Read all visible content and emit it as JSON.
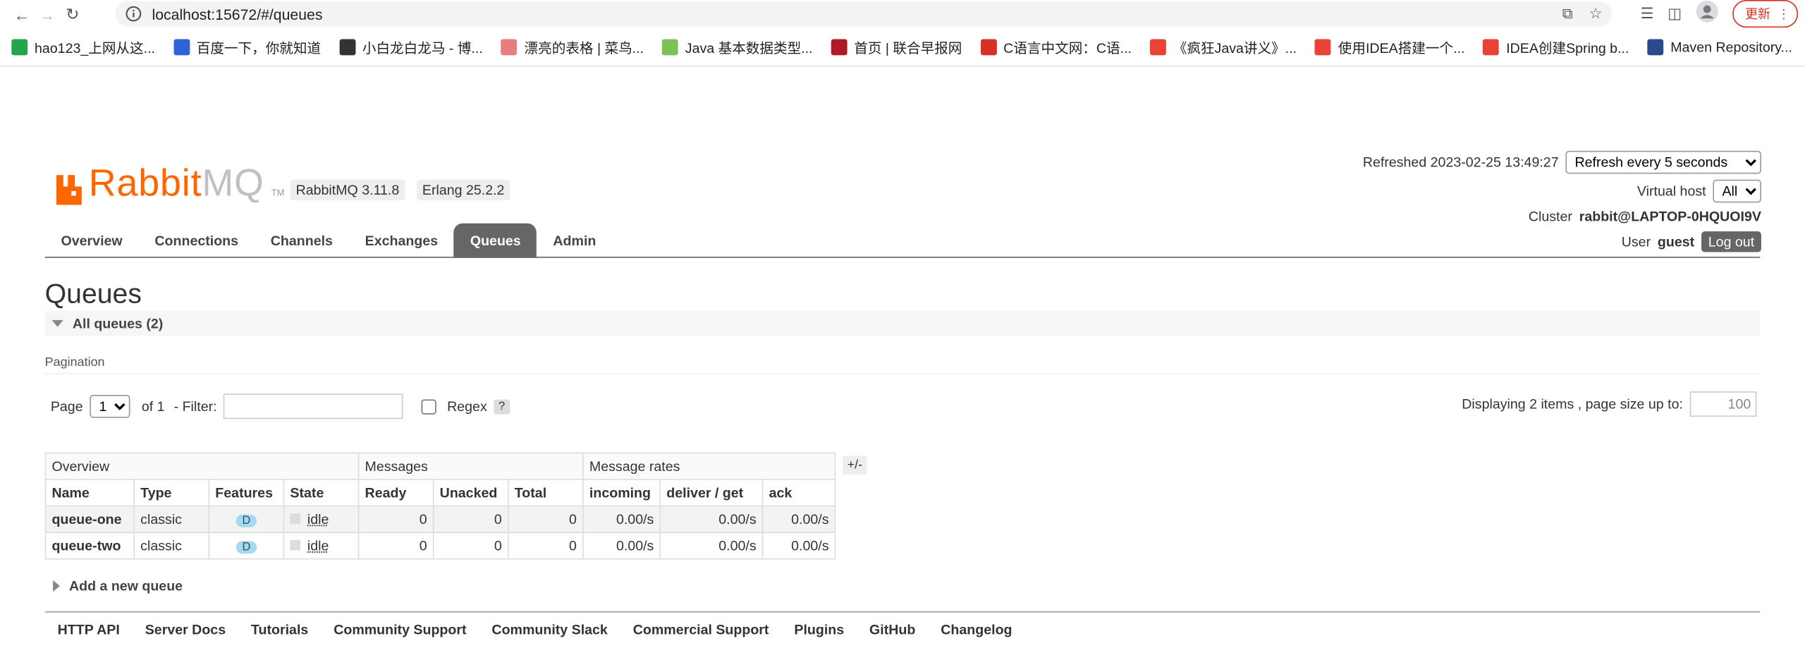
{
  "browser": {
    "url": "localhost:15672/#/queues",
    "update_label": "更新",
    "bookmarks": [
      {
        "label": "hao123_上网从这...",
        "color": "#26a44a"
      },
      {
        "label": "百度一下，你就知道",
        "color": "#2f62db"
      },
      {
        "label": "小白龙白龙马 - 博...",
        "color": "#333333"
      },
      {
        "label": "漂亮的表格 | 菜鸟...",
        "color": "#e67e7e"
      },
      {
        "label": "Java 基本数据类型...",
        "color": "#7fbf5a"
      },
      {
        "label": "首页 | 联合早报网",
        "color": "#b11a24"
      },
      {
        "label": "C语言中文网：C语...",
        "color": "#d93025"
      },
      {
        "label": "《疯狂Java讲义》...",
        "color": "#ea4335"
      },
      {
        "label": "使用IDEA搭建一个...",
        "color": "#ea4335"
      },
      {
        "label": "IDEA创建Spring b...",
        "color": "#ea4335"
      },
      {
        "label": "Maven Repository...",
        "color": "#2b4a8b"
      }
    ],
    "more": "»"
  },
  "header": {
    "logo_main": "Rabbit",
    "logo_mq": "MQ",
    "logo_tm": "TM",
    "rabbitmq_version": "RabbitMQ 3.11.8",
    "erlang_version": "Erlang 25.2.2",
    "refreshed_label": "Refreshed 2023-02-25 13:49:27",
    "refresh_select": "Refresh every 5 seconds",
    "vhost_label": "Virtual host",
    "vhost_value": "All",
    "cluster_label": "Cluster",
    "cluster_value": "rabbit@LAPTOP-0HQUOI9V",
    "user_label": "User",
    "user_value": "guest",
    "logout": "Log out"
  },
  "tabs": [
    "Overview",
    "Connections",
    "Channels",
    "Exchanges",
    "Queues",
    "Admin"
  ],
  "active_tab": "Queues",
  "page": {
    "title": "Queues",
    "section": "All queues (2)",
    "pagination_title": "Pagination",
    "page_label": "Page",
    "page_value": "1",
    "of_label": "of 1",
    "filter_label": "- Filter:",
    "regex_label": "Regex",
    "help": "?",
    "displaying": "Displaying 2 items , page size up to:",
    "page_size": "100",
    "plus_minus": "+/-",
    "add_queue": "Add a new queue"
  },
  "table": {
    "groups": [
      "Overview",
      "Messages",
      "Message rates"
    ],
    "columns": [
      "Name",
      "Type",
      "Features",
      "State",
      "Ready",
      "Unacked",
      "Total",
      "incoming",
      "deliver / get",
      "ack"
    ],
    "rows": [
      {
        "name": "queue-one",
        "type": "classic",
        "feature": "D",
        "state": "idle",
        "ready": "0",
        "unacked": "0",
        "total": "0",
        "incoming": "0.00/s",
        "deliver": "0.00/s",
        "ack": "0.00/s"
      },
      {
        "name": "queue-two",
        "type": "classic",
        "feature": "D",
        "state": "idle",
        "ready": "0",
        "unacked": "0",
        "total": "0",
        "incoming": "0.00/s",
        "deliver": "0.00/s",
        "ack": "0.00/s"
      }
    ]
  },
  "footer": [
    "HTTP API",
    "Server Docs",
    "Tutorials",
    "Community Support",
    "Community Slack",
    "Commercial Support",
    "Plugins",
    "GitHub",
    "Changelog"
  ]
}
